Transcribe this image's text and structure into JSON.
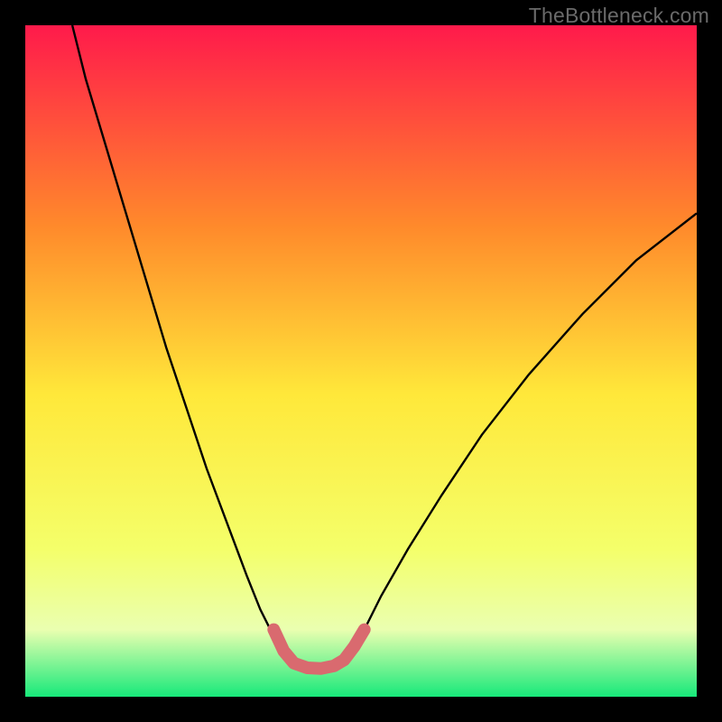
{
  "attribution": "TheBottleneck.com",
  "chart_data": {
    "type": "line",
    "title": "",
    "xlabel": "",
    "ylabel": "",
    "xlim": [
      0,
      100
    ],
    "ylim": [
      0,
      100
    ],
    "grid": false,
    "legend": false,
    "background_gradient": {
      "top": "#ff1a4b",
      "mid_upper": "#ff8a2b",
      "mid": "#ffe83a",
      "mid_lower": "#f4ff6a",
      "band": "#eaffb0",
      "bottom": "#17e97a"
    },
    "series": [
      {
        "name": "left-curve",
        "color": "#000000",
        "points": [
          [
            7,
            100
          ],
          [
            9,
            92
          ],
          [
            12,
            82
          ],
          [
            15,
            72
          ],
          [
            18,
            62
          ],
          [
            21,
            52
          ],
          [
            24,
            43
          ],
          [
            27,
            34
          ],
          [
            30,
            26
          ],
          [
            33,
            18
          ],
          [
            35,
            13
          ],
          [
            37,
            9
          ],
          [
            38.5,
            6.5
          ],
          [
            40,
            5
          ]
        ]
      },
      {
        "name": "right-curve",
        "color": "#000000",
        "points": [
          [
            47,
            5
          ],
          [
            48.5,
            6.5
          ],
          [
            50,
            9
          ],
          [
            53,
            15
          ],
          [
            57,
            22
          ],
          [
            62,
            30
          ],
          [
            68,
            39
          ],
          [
            75,
            48
          ],
          [
            83,
            57
          ],
          [
            91,
            65
          ],
          [
            100,
            72
          ]
        ]
      },
      {
        "name": "bottleneck-band",
        "color": "#d96a6f",
        "width_thick": true,
        "points": [
          [
            37,
            10
          ],
          [
            38.5,
            6.8
          ],
          [
            40,
            5
          ],
          [
            42,
            4.3
          ],
          [
            44,
            4.2
          ],
          [
            46,
            4.6
          ],
          [
            47.5,
            5.5
          ],
          [
            49,
            7.5
          ],
          [
            50.5,
            10
          ]
        ]
      }
    ]
  }
}
